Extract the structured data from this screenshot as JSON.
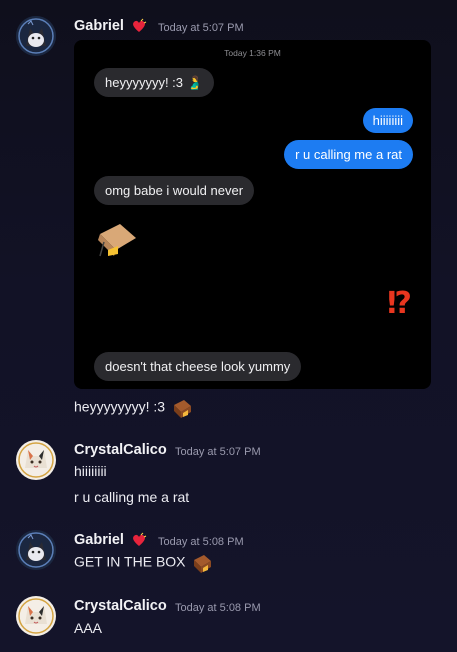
{
  "messages": [
    {
      "user": "Gabriel",
      "timestamp": "Today at 5:07 PM",
      "attachment": {
        "time": "Today 1:36 PM",
        "bubbles": [
          {
            "dir": "in",
            "text": "heyyyyyyy! :3 🫃"
          },
          {
            "dir": "out",
            "text": "hiiiiiiii"
          },
          {
            "dir": "out",
            "text": "r u calling me a rat"
          },
          {
            "dir": "in",
            "text": "omg babe i would never"
          },
          {
            "dir": "in",
            "text": "doesn't that cheese look yummy"
          }
        ],
        "emoji_trap": "box-trap-with-cheese",
        "interrobang": "⁉"
      },
      "text": "heyyyyyyyy! :3"
    },
    {
      "user": "CrystalCalico",
      "timestamp": "Today at 5:07 PM",
      "lines": [
        "hiiiiiiii",
        "r u calling me a rat"
      ]
    },
    {
      "user": "Gabriel",
      "timestamp": "Today at 5:08 PM",
      "text": "GET IN THE BOX"
    },
    {
      "user": "CrystalCalico",
      "timestamp": "Today at 5:08 PM",
      "text": "AAA"
    }
  ],
  "colors": {
    "background": "#12121f",
    "outgoing_bubble": "#1d7cf2",
    "incoming_bubble": "#2a2a2e",
    "heart_badge": "#e8243c",
    "interrobang": "#e8361f"
  }
}
